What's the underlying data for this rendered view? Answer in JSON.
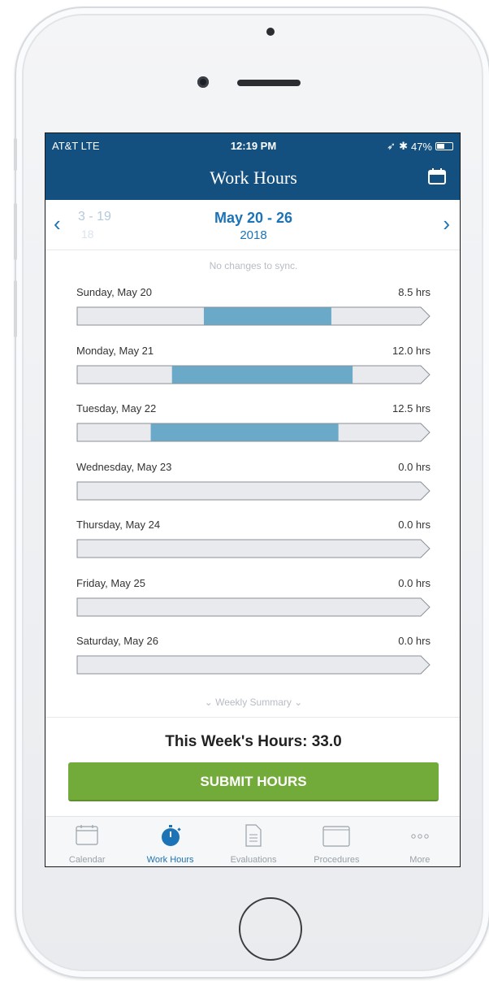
{
  "status_bar": {
    "carrier": "AT&T  LTE",
    "time": "12:19 PM",
    "battery": "47%"
  },
  "header": {
    "title": "Work Hours"
  },
  "week_nav": {
    "prev_range": "3 - 19",
    "prev_year": "18",
    "current_range": "May 20 - 26",
    "current_year": "2018"
  },
  "sync_status": "No changes to sync.",
  "days": [
    {
      "label": "Sunday, May 20",
      "hours": "8.5 hrs",
      "fill_start": 0.36,
      "fill_end": 0.72
    },
    {
      "label": "Monday, May 21",
      "hours": "12.0 hrs",
      "fill_start": 0.27,
      "fill_end": 0.78
    },
    {
      "label": "Tuesday, May 22",
      "hours": "12.5 hrs",
      "fill_start": 0.21,
      "fill_end": 0.74
    },
    {
      "label": "Wednesday, May 23",
      "hours": "0.0 hrs",
      "fill_start": 0,
      "fill_end": 0
    },
    {
      "label": "Thursday, May 24",
      "hours": "0.0 hrs",
      "fill_start": 0,
      "fill_end": 0
    },
    {
      "label": "Friday, May 25",
      "hours": "0.0 hrs",
      "fill_start": 0,
      "fill_end": 0
    },
    {
      "label": "Saturday, May 26",
      "hours": "0.0 hrs",
      "fill_start": 0,
      "fill_end": 0
    }
  ],
  "weekly_summary_label": "Weekly Summary",
  "week_total": "This Week's Hours: 33.0",
  "submit_label": "SUBMIT HOURS",
  "tabs": [
    {
      "label": "Calendar",
      "icon": "calendar-icon",
      "active": false
    },
    {
      "label": "Work Hours",
      "icon": "stopwatch-icon",
      "active": true
    },
    {
      "label": "Evaluations",
      "icon": "document-icon",
      "active": false
    },
    {
      "label": "Procedures",
      "icon": "folder-icon",
      "active": false
    },
    {
      "label": "More",
      "icon": "more-dots-icon",
      "active": false
    }
  ],
  "colors": {
    "header_bg": "#14507f",
    "accent_blue": "#1c73b5",
    "bar_fill": "#6aaac8",
    "bar_empty": "#e8eaed",
    "submit_green": "#73ab3a"
  }
}
